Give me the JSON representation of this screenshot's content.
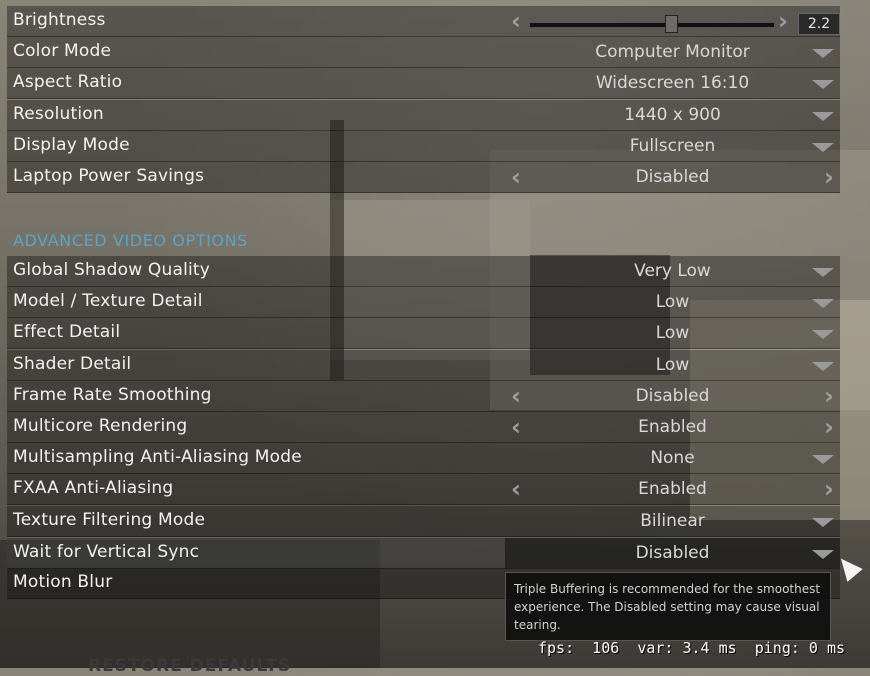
{
  "brightness": {
    "label": "Brightness",
    "value": "2.2",
    "level": 0.58
  },
  "settings": [
    {
      "label": "Color Mode",
      "value": "Computer Monitor",
      "kind": "dropdown"
    },
    {
      "label": "Aspect Ratio",
      "value": "Widescreen 16:10",
      "kind": "dropdown"
    },
    {
      "label": "Resolution",
      "value": "1440 x 900",
      "kind": "dropdown"
    },
    {
      "label": "Display Mode",
      "value": "Fullscreen",
      "kind": "dropdown"
    },
    {
      "label": "Laptop Power Savings",
      "value": "Disabled",
      "kind": "stepper"
    }
  ],
  "advanced_header": "ADVANCED VIDEO OPTIONS",
  "advanced": [
    {
      "label": "Global Shadow Quality",
      "value": "Very Low",
      "kind": "dropdown"
    },
    {
      "label": "Model / Texture Detail",
      "value": "Low",
      "kind": "dropdown"
    },
    {
      "label": "Effect Detail",
      "value": "Low",
      "kind": "dropdown"
    },
    {
      "label": "Shader Detail",
      "value": "Low",
      "kind": "dropdown"
    },
    {
      "label": "Frame Rate Smoothing",
      "value": "Disabled",
      "kind": "stepper"
    },
    {
      "label": "Multicore Rendering",
      "value": "Enabled",
      "kind": "stepper"
    },
    {
      "label": "Multisampling Anti-Aliasing Mode",
      "value": "None",
      "kind": "dropdown"
    },
    {
      "label": "FXAA Anti-Aliasing",
      "value": "Enabled",
      "kind": "stepper"
    },
    {
      "label": "Texture Filtering Mode",
      "value": "Bilinear",
      "kind": "dropdown"
    },
    {
      "label": "Wait for Vertical Sync",
      "value": "Disabled",
      "kind": "dropdown",
      "active": true
    },
    {
      "label": "Motion Blur",
      "value": "",
      "kind": "none"
    }
  ],
  "tooltip": "Triple Buffering is recommended for the smoothest experience. The Disabled setting may cause visual tearing.",
  "fps_overlay": "fps:  106  var: 3.4 ms  ping: 0 ms",
  "footer_label": "RESTORE DEFAULTS"
}
